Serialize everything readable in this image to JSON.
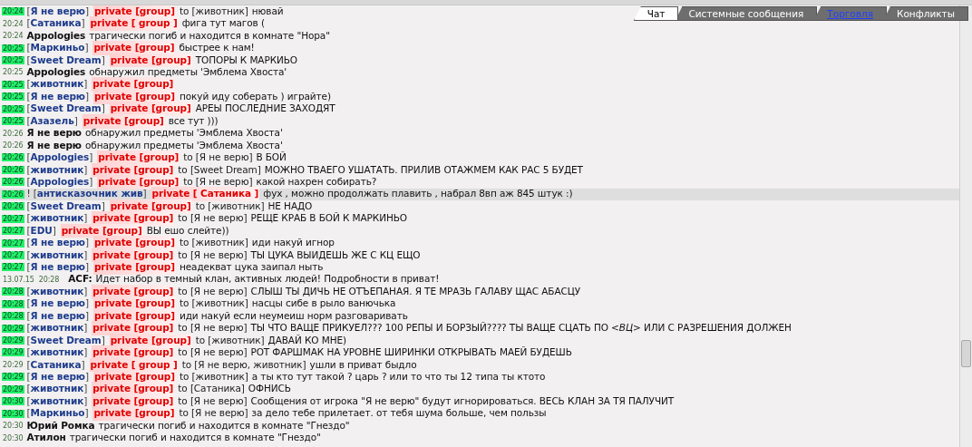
{
  "tabs": [
    {
      "label": "Чат",
      "selected": true,
      "unread": false
    },
    {
      "label": "Системные сообщения",
      "selected": false,
      "unread": false
    },
    {
      "label": "Торговля",
      "selected": false,
      "unread": true
    },
    {
      "label": "Конфликты",
      "selected": false,
      "unread": false
    }
  ],
  "messages": [
    {
      "kind": "private",
      "time": "20:24",
      "time_flag": true,
      "highlighted": false,
      "sender": "[**Я не верю**]",
      "channel": "private [group]",
      "to": "to [животник]",
      "text": "нювай"
    },
    {
      "kind": "private",
      "time": "20:24",
      "time_flag": false,
      "highlighted": false,
      "sender": "[**Сатаника**]",
      "channel": "private [ group ]",
      "text": "фига тут магов ("
    },
    {
      "kind": "system",
      "time": "20:24",
      "time_flag": false,
      "highlighted": false,
      "actor": "Appologies",
      "text": "трагически погиб и находится в комнате \"Нора\""
    },
    {
      "kind": "private",
      "time": "20:25",
      "time_flag": true,
      "highlighted": false,
      "sender": "[**Маркиньо**]",
      "channel": "private [group]",
      "text": "быстрее к нам!"
    },
    {
      "kind": "private",
      "time": "20:25",
      "time_flag": true,
      "highlighted": false,
      "sender": "[**Sweet Dream**]",
      "channel": "private [group]",
      "text": "ТОПОРЫ К МАРКИЬО"
    },
    {
      "kind": "system",
      "time": "20:25",
      "time_flag": false,
      "highlighted": false,
      "actor": "Appologies",
      "text": "обнаружил предметы 'Эмблема Хвоста'"
    },
    {
      "kind": "private",
      "time": "20:25",
      "time_flag": true,
      "highlighted": false,
      "sender": "[**животник**]",
      "channel": "private [group]"
    },
    {
      "kind": "private",
      "time": "20:25",
      "time_flag": true,
      "highlighted": false,
      "sender": "[**Я не верю**]",
      "channel": "private [group]",
      "text": "покуй иду соберать ) играйте)"
    },
    {
      "kind": "private",
      "time": "20:25",
      "time_flag": true,
      "highlighted": false,
      "sender": "[**Sweet Dream**]",
      "channel": "private [group]",
      "text": "АРЕЫ ПОСЛЕДНИЕ ЗАХОДЯТ"
    },
    {
      "kind": "private",
      "time": "20:25",
      "time_flag": true,
      "highlighted": false,
      "sender": "[**Азазель**]",
      "channel": "private [group]",
      "text": "все тут )))"
    },
    {
      "kind": "system",
      "time": "20:26",
      "time_flag": false,
      "highlighted": false,
      "actor": "Я не верю",
      "text": "обнаружил предметы 'Эмблема Хвоста'"
    },
    {
      "kind": "system",
      "time": "20:26",
      "time_flag": false,
      "highlighted": false,
      "actor": "Я не верю",
      "text": "обнаружил предметы 'Эмблема Хвоста'"
    },
    {
      "kind": "private",
      "time": "20:26",
      "time_flag": true,
      "highlighted": false,
      "sender": "[**Appologies**]",
      "channel": "private [group]",
      "to": "to [Я не верю]",
      "text": "В БОЙ"
    },
    {
      "kind": "private",
      "time": "20:26",
      "time_flag": true,
      "highlighted": false,
      "sender": "[**животник**]",
      "channel": "private [group]",
      "to": "to [Sweet Dream]",
      "text": "МОЖНО ТВАЕГО УШАТАТЬ. ПРИЛИВ ОТАЖМЕМ КАК РАС 5 БУДЕТ"
    },
    {
      "kind": "private",
      "time": "20:26",
      "time_flag": true,
      "highlighted": false,
      "sender": "[**Appologies**]",
      "channel": "private [group]",
      "to": "to [Я не верю]",
      "text": "какой нахрен собирать?"
    },
    {
      "kind": "private",
      "time": "20:26",
      "time_flag": true,
      "highlighted": true,
      "alert": "!",
      "sender": "[**антисказочник жив**]",
      "channel": "private [ Сатаника ]",
      "text": "фух , можно продолжать плавить , набрал 8вп аж 845 штук :)"
    },
    {
      "kind": "private",
      "time": "20:26",
      "time_flag": true,
      "highlighted": false,
      "sender": "[**Sweet Dream**]",
      "channel": "private [group]",
      "to": "to [животник]",
      "text": "НЕ НАДО"
    },
    {
      "kind": "private",
      "time": "20:27",
      "time_flag": true,
      "highlighted": false,
      "sender": "[**животник**]",
      "channel": "private [group]",
      "to": "to [Я не верю]",
      "text": "РЕЩЕ КРАБ В БОЙ К МАРКИНЬО"
    },
    {
      "kind": "private",
      "time": "20:27",
      "time_flag": true,
      "highlighted": false,
      "sender": "[**EDU**]",
      "channel": "private [group]",
      "text": "ВЫ ешо слейте))"
    },
    {
      "kind": "private",
      "time": "20:27",
      "time_flag": true,
      "highlighted": false,
      "sender": "[**Я не верю**]",
      "channel": "private [group]",
      "to": "to [животник]",
      "text": "иди накуй игнор"
    },
    {
      "kind": "private",
      "time": "20:27",
      "time_flag": true,
      "highlighted": false,
      "sender": "[**животник**]",
      "channel": "private [group]",
      "to": "to [Я не верю]",
      "text": "ТЫ ЦУКА ВЫИДЕШЬ ЖЕ С КЦ ЕЩО"
    },
    {
      "kind": "private",
      "time": "20:27",
      "time_flag": true,
      "highlighted": false,
      "sender": "[**Я не верю**]",
      "channel": "private [group]",
      "text": "неадекват цука заипал ныть"
    },
    {
      "kind": "announcement",
      "time": "13.07.15  20:28",
      "time_flag": false,
      "highlighted": false,
      "actor": "ACF:",
      "text": "Идет набор в темный клан, активных людей! Подробности в приват!"
    },
    {
      "kind": "private",
      "time": "20:28",
      "time_flag": true,
      "highlighted": false,
      "sender": "[**животник**]",
      "channel": "private [group]",
      "to": "to [Я не верю]",
      "text": "СЛЫШ ТЫ ДИЧЬ НЕ ОТЪЕПАНАЯ. Я ТЕ МРАЗЬ ГАЛАВУ ЩАС АБАСЦУ"
    },
    {
      "kind": "private",
      "time": "20:28",
      "time_flag": true,
      "highlighted": false,
      "sender": "[**Я не верю**]",
      "channel": "private [group]",
      "to": "to [животник]",
      "text": "насцы сибе в рыло ванючька"
    },
    {
      "kind": "private",
      "time": "20:28",
      "time_flag": true,
      "highlighted": false,
      "sender": "[**Я не верю**]",
      "channel": "private [group]",
      "text": "иди накуй если неумеиш норм разговаривать"
    },
    {
      "kind": "private",
      "time": "20:29",
      "time_flag": true,
      "highlighted": false,
      "sender": "[**животник**]",
      "channel": "private [group]",
      "to": "to [Я не верю]",
      "text": "ТЫ ЧТО ВАЩЕ ПРИКУЕЛ??? 100 РЕПЫ И БОРЗЫЙ???? ТЫ ВАЩЕ СЦАТЬ ПО *<ВЦ>* ИЛИ С РАЗРЕШЕНИЯ ДОЛЖЕН"
    },
    {
      "kind": "private",
      "time": "20:29",
      "time_flag": true,
      "highlighted": false,
      "sender": "[**Sweet Dream**]",
      "channel": "private [group]",
      "to": "to [животник]",
      "text": "ДАВАЙ КО МНЕ)"
    },
    {
      "kind": "private",
      "time": "20:29",
      "time_flag": true,
      "highlighted": false,
      "sender": "[**животник**]",
      "channel": "private [group]",
      "to": "to [Я не верю]",
      "text": "РОТ ФАРШМАК НА УРОВНЕ ШИРИНКИ ОТКРЫВАТЬ МАЕЙ БУДЕШЬ"
    },
    {
      "kind": "private",
      "time": "20:29",
      "time_flag": false,
      "highlighted": false,
      "sender": "[**Сатаника**]",
      "channel": "private [ group ]",
      "to": "to [Я не верю, животник]",
      "text": "ушли в приват быдло"
    },
    {
      "kind": "private",
      "time": "20:29",
      "time_flag": true,
      "highlighted": false,
      "sender": "[**Я не верю**]",
      "channel": "private [group]",
      "to": "to [животник]",
      "text": "а ты кто тут такой ? царь ? или то что ты 12 типа ты ктото"
    },
    {
      "kind": "private",
      "time": "20:29",
      "time_flag": true,
      "highlighted": false,
      "sender": "[**животник**]",
      "channel": "private [group]",
      "to": "to [Сатаника]",
      "text": "ОФНИСЬ"
    },
    {
      "kind": "private",
      "time": "20:30",
      "time_flag": true,
      "highlighted": false,
      "sender": "[**животник**]",
      "channel": "private [group]",
      "to": "to [Я не верю]",
      "text": "Сообщения от игрока \"Я не верю\" будут игнорироваться. ВЕСЬ КЛАН ЗА ТЯ ПАЛУЧИТ"
    },
    {
      "kind": "private",
      "time": "20:30",
      "time_flag": true,
      "highlighted": false,
      "sender": "[**Маркиньо**]",
      "channel": "private [group]",
      "to": "to [Я не верю]",
      "text": "за дело тебе прилетает. от тебя шума больше, чем пользы"
    },
    {
      "kind": "system",
      "time": "20:30",
      "time_flag": false,
      "highlighted": false,
      "actor": "Юрий Ромка",
      "text": "трагически погиб и находится в комнате \"Гнездо\""
    },
    {
      "kind": "system",
      "time": "20:30",
      "time_flag": false,
      "highlighted": false,
      "actor": "Атилон",
      "text": "трагически погиб и находится в комнате \"Гнездо\""
    }
  ]
}
